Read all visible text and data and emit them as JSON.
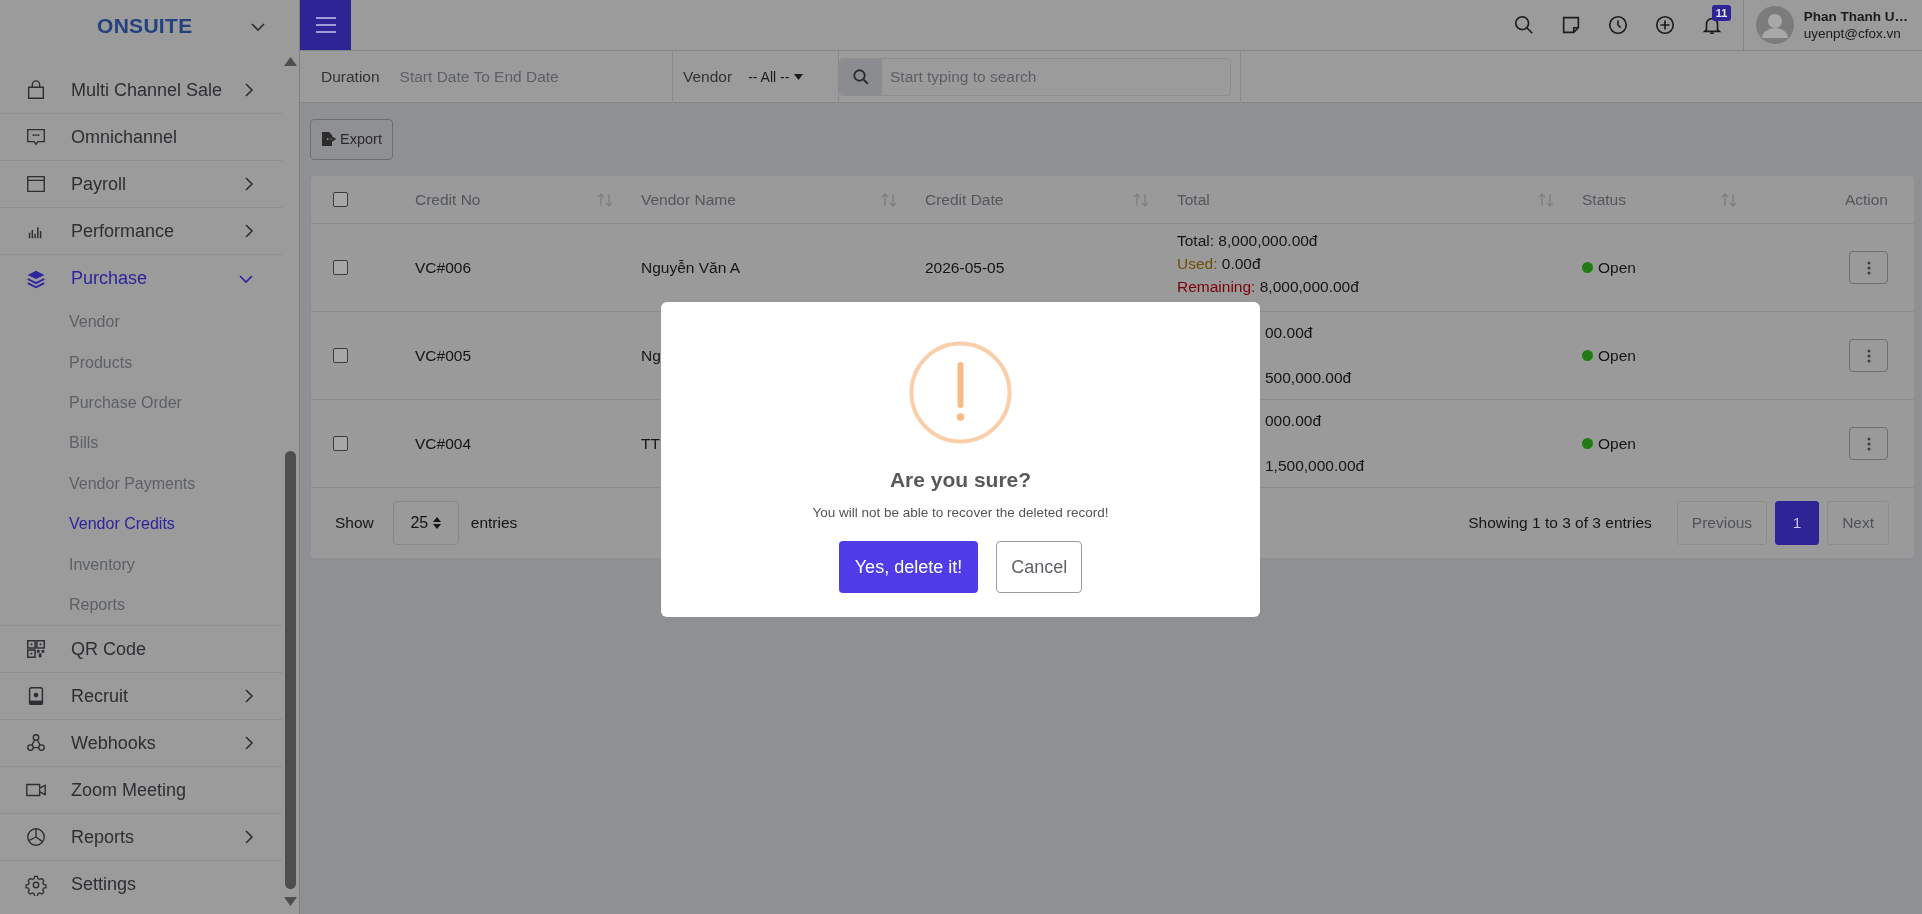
{
  "sidebar": {
    "logo": "ONSUITE",
    "items": [
      {
        "label": "Multi Channel Sale",
        "expandable": true,
        "expanded": false,
        "selected": false
      },
      {
        "label": "Omnichannel",
        "expandable": false,
        "expanded": false,
        "selected": false
      },
      {
        "label": "Payroll",
        "expandable": true,
        "expanded": false,
        "selected": false
      },
      {
        "label": "Performance",
        "expandable": true,
        "expanded": false,
        "selected": false
      },
      {
        "label": "Purchase",
        "expandable": true,
        "expanded": true,
        "selected": true,
        "children": [
          {
            "label": "Vendor",
            "selected": false
          },
          {
            "label": "Products",
            "selected": false
          },
          {
            "label": "Purchase Order",
            "selected": false
          },
          {
            "label": "Bills",
            "selected": false
          },
          {
            "label": "Vendor Payments",
            "selected": false
          },
          {
            "label": "Vendor Credits",
            "selected": true
          },
          {
            "label": "Inventory",
            "selected": false
          },
          {
            "label": "Reports",
            "selected": false
          }
        ]
      },
      {
        "label": "QR Code",
        "expandable": false,
        "expanded": false,
        "selected": false
      },
      {
        "label": "Recruit",
        "expandable": true,
        "expanded": false,
        "selected": false
      },
      {
        "label": "Webhooks",
        "expandable": true,
        "expanded": false,
        "selected": false
      },
      {
        "label": "Zoom Meeting",
        "expandable": false,
        "expanded": false,
        "selected": false
      },
      {
        "label": "Reports",
        "expandable": true,
        "expanded": false,
        "selected": false
      },
      {
        "label": "Settings",
        "expandable": false,
        "expanded": false,
        "selected": false
      }
    ]
  },
  "topbar": {
    "notification_count": "11",
    "user": {
      "name": "Phan Thanh U…",
      "email": "uyenpt@cfox.vn"
    }
  },
  "filters": {
    "duration": {
      "label": "Duration",
      "placeholder": "Start Date To End Date"
    },
    "vendor": {
      "label": "Vendor",
      "value": "-- All --"
    },
    "search": {
      "placeholder": "Start typing to search"
    }
  },
  "toolbar": {
    "export_button": "Export"
  },
  "table": {
    "header_checked": false,
    "columns": [
      {
        "label": "Credit No",
        "sortable": true
      },
      {
        "label": "Vendor Name",
        "sortable": true
      },
      {
        "label": "Credit Date",
        "sortable": true
      },
      {
        "label": "Total",
        "sortable": true
      },
      {
        "label": "Status",
        "sortable": true
      },
      {
        "label": "Action",
        "sortable": false
      }
    ],
    "rows": [
      {
        "checked": false,
        "covered": false,
        "credit_no": "VC#006",
        "vendor_name": "Nguyễn Văn A",
        "credit_date": "2026-05-05",
        "total": [
          {
            "kind": "total",
            "label": "Total:",
            "value": "8,000,000.00đ"
          },
          {
            "kind": "used",
            "label": "Used:",
            "value": "0.00đ"
          },
          {
            "kind": "remaining",
            "label": "Remaining:",
            "value": "8,000,000.00đ"
          }
        ],
        "status": {
          "label": "Open",
          "color": "#1f7d12"
        }
      },
      {
        "checked": false,
        "covered": true,
        "credit_no": "VC#005",
        "vendor_name": "Ng",
        "total": [
          {
            "value": "00.00đ"
          },
          {
            "value": "500,000.00đ"
          }
        ],
        "status": {
          "label": "Open",
          "color": "#1f7d12"
        }
      },
      {
        "checked": false,
        "covered": true,
        "credit_no": "VC#004",
        "vendor_name": "TT",
        "total": [
          {
            "value": "000.00đ"
          },
          {
            "value": "1,500,000.00đ"
          }
        ],
        "status": {
          "label": "Open",
          "color": "#1f7d12"
        }
      }
    ]
  },
  "footer": {
    "show_label": "Show",
    "page_size": "25",
    "entries_label": "entries",
    "info": "Showing 1 to 3 of 3 entries",
    "pages": [
      {
        "label": "Previous",
        "selected": false
      },
      {
        "label": "1",
        "selected": true
      },
      {
        "label": "Next",
        "selected": false
      }
    ]
  },
  "dialog": {
    "title": "Are you sure?",
    "text": "You will not be able to recover the deleted record!",
    "buttons": [
      {
        "label": "Yes, delete it!",
        "kind": "confirm"
      },
      {
        "label": "Cancel",
        "kind": "cancel"
      }
    ]
  }
}
